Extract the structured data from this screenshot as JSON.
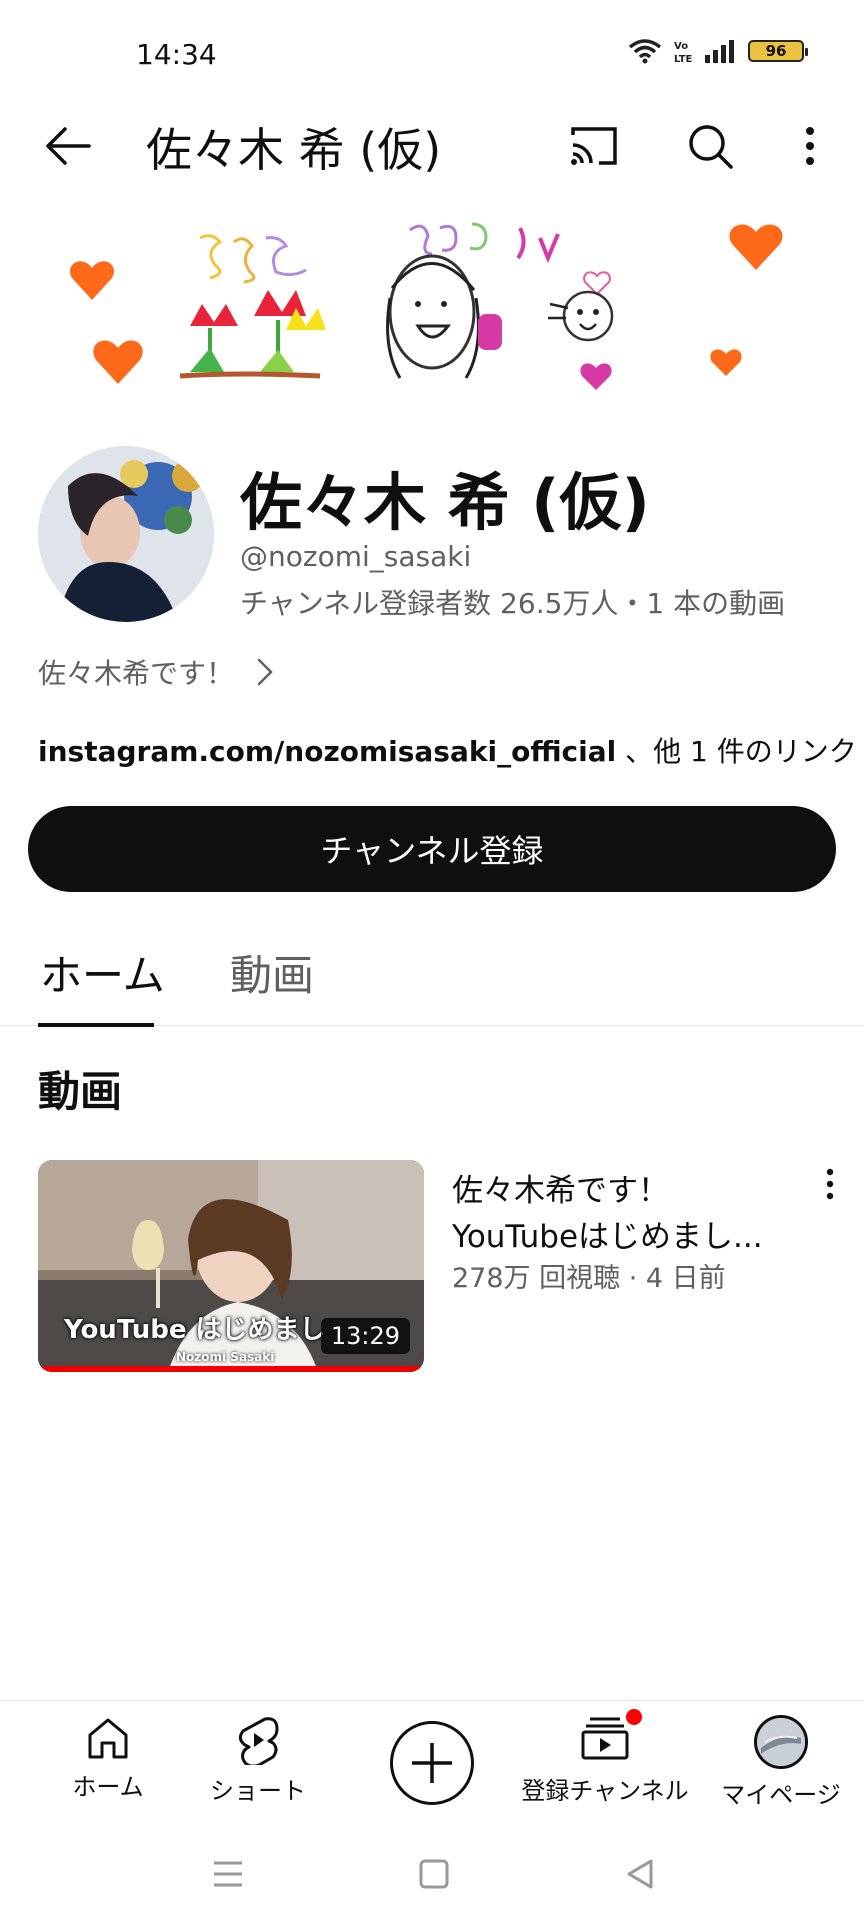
{
  "status_bar": {
    "time": "14:34",
    "battery": "96"
  },
  "app_bar": {
    "title": "佐々木 希 (仮)"
  },
  "channel": {
    "name": "佐々木 希 (仮)",
    "handle": "@nozomi_sasaki",
    "stats": "チャンネル登録者数 26.5万人・1 本の動画",
    "description": "佐々木希です！",
    "link_main": "instagram.com/nozomisasaki_official",
    "link_more": " 、他 1 件のリンク",
    "subscribe_label": "チャンネル登録"
  },
  "tabs": [
    {
      "label": "ホーム",
      "selected": true
    },
    {
      "label": "動画",
      "selected": false
    }
  ],
  "section": {
    "title": "動画"
  },
  "videos": [
    {
      "title_line1": "佐々木希です！",
      "title_line2": "YouTubeはじめまし...",
      "meta": "278万 回視聴 · 4 日前",
      "thumb_caption": "YouTube はじめまし",
      "thumb_subcaption": "Nozomi Sasaki",
      "duration": "13:29",
      "watched_progress": 1.0
    }
  ],
  "bottom_nav": {
    "home": "ホーム",
    "shorts": "ショート",
    "subscriptions": "登録チャンネル",
    "me": "マイページ"
  },
  "colors": {
    "primary": "#0f0f0f",
    "secondary_text": "#606060",
    "accent_red": "#ff0000"
  }
}
